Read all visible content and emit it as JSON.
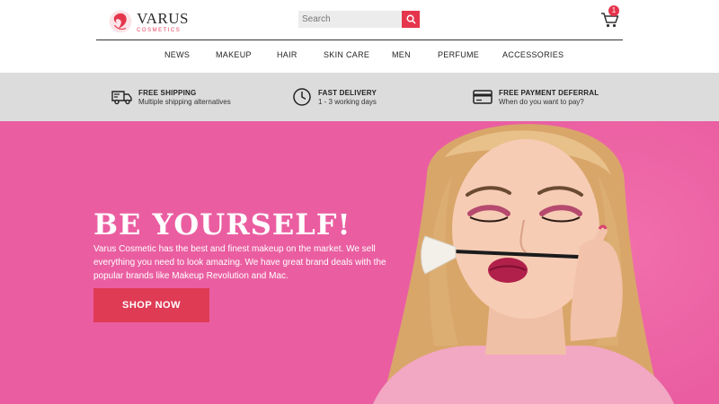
{
  "brand": {
    "name": "VARUS",
    "tagline": "COSMETICS",
    "accent": "#e5354c",
    "hero_bg": "#ea5ea1"
  },
  "search": {
    "placeholder": "Search",
    "icon": "search-icon"
  },
  "cart": {
    "icon": "cart-icon",
    "count": "1"
  },
  "nav": {
    "items": [
      "NEWS",
      "MAKEUP",
      "HAIR",
      "SKIN CARE",
      "MEN",
      "PERFUME",
      "ACCESSORIES"
    ]
  },
  "features": [
    {
      "icon": "truck-icon",
      "title": "FREE SHIPPING",
      "subtitle": "Multiple shipping alternatives"
    },
    {
      "icon": "clock-icon",
      "title": "FAST DELIVERY",
      "subtitle": "1 - 3 working days"
    },
    {
      "icon": "credit-card-icon",
      "title": "FREE PAYMENT DEFERRAL",
      "subtitle": "When do you want to pay?"
    }
  ],
  "hero": {
    "title": "BE YOURSELF!",
    "description": "Varus Cosmetic has the best and finest makeup on the market. We sell everything you need to look amazing. We have great brand deals with the popular brands like Makeup Revolution and Mac.",
    "button_label": "SHOP NOW"
  }
}
